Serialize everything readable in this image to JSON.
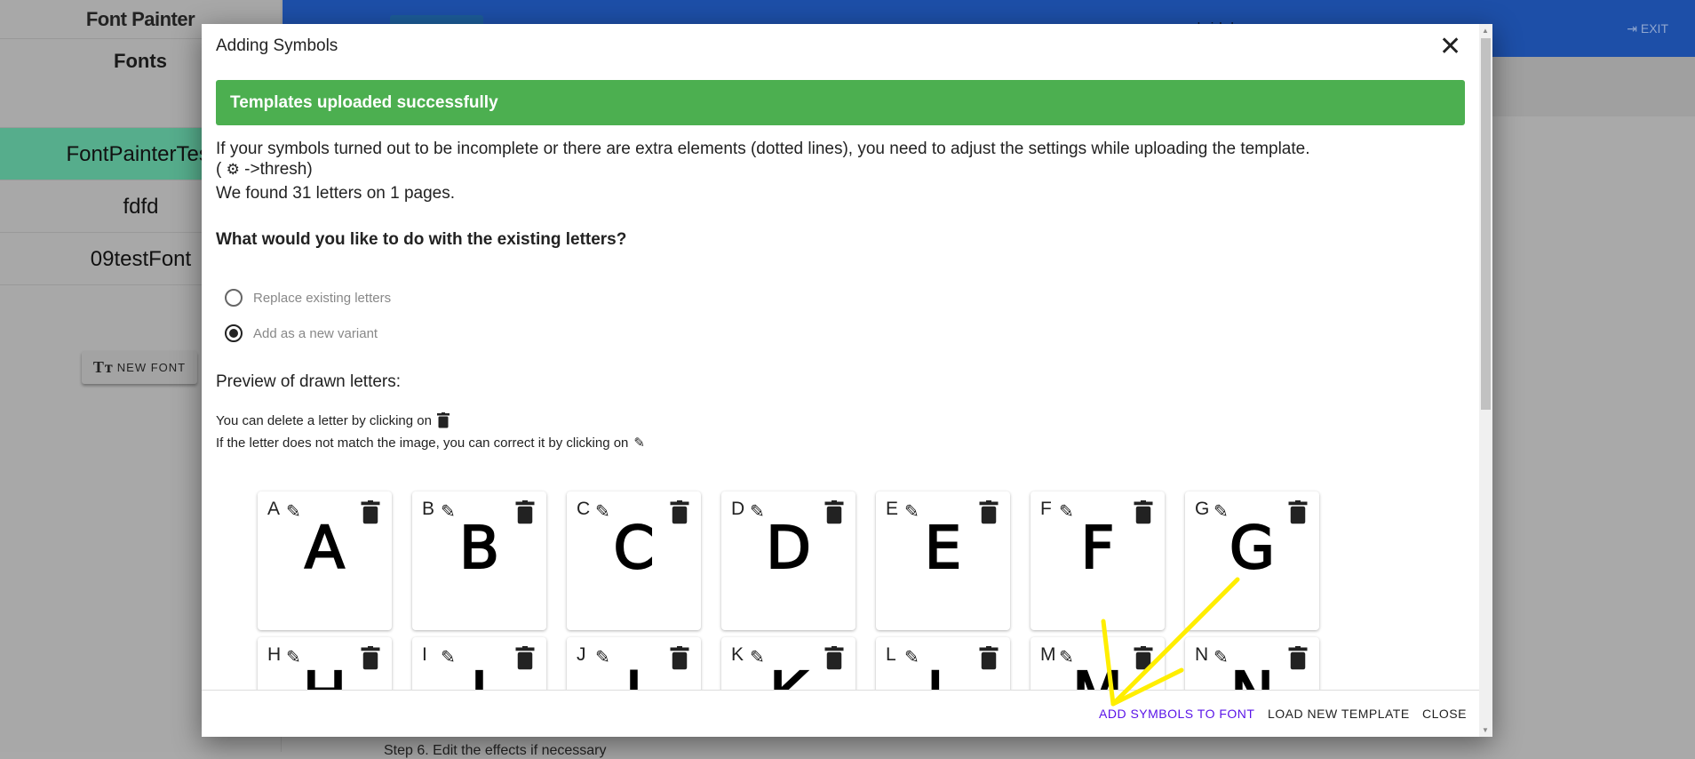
{
  "sidebar": {
    "app_title": "Font Painter",
    "section_title": "Fonts",
    "fonts": [
      "FontPainterTest",
      "fdfd",
      "09testFont"
    ],
    "new_font_label": "NEW FONT"
  },
  "header": {
    "email": "pbridal.com",
    "exit_label": "EXIT"
  },
  "background": {
    "step_text": "Step 6. Edit the effects if necessary"
  },
  "modal": {
    "title": "Adding Symbols",
    "alert": "Templates uploaded successfully",
    "alert_color": "#4caf50",
    "info_line1": "If your symbols turned out to be incomplete or there are extra elements (dotted lines), you need to adjust the settings while uploading the template.",
    "info_line2_open": "(",
    "info_line2_rest": "->thresh)",
    "found": "We found 31 letters on 1 pages.",
    "question": "What would you like to do with the existing letters?",
    "options": [
      {
        "label": "Replace existing letters",
        "selected": false
      },
      {
        "label": "Add as a new variant",
        "selected": true
      }
    ],
    "preview_heading": "Preview of drawn letters:",
    "delete_hint": "You can delete a letter by clicking on",
    "edit_hint": "If the letter does not match the image, you can correct it by clicking on",
    "letters": [
      "A",
      "B",
      "C",
      "D",
      "E",
      "F",
      "G",
      "H",
      "I",
      "J",
      "K",
      "L",
      "M",
      "N"
    ],
    "footer": {
      "add": "ADD SYMBOLS TO FONT",
      "load": "LOAD NEW TEMPLATE",
      "close": "CLOSE"
    },
    "accent": "#5a14e8"
  }
}
